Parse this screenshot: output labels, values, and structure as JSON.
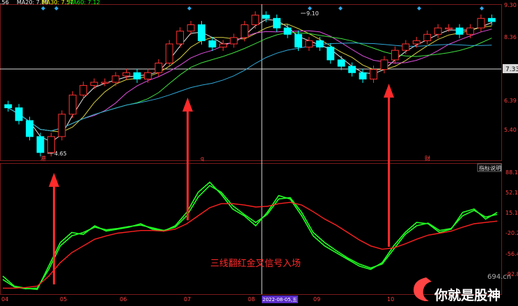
{
  "legend": [
    {
      "text": "MA20: 7.88",
      "color": "#e8e8e8"
    },
    {
      "text": "MA30: 7.57",
      "color": "#ffff00"
    },
    {
      "text": "MA60: 7.12",
      "color": "#00ff00"
    }
  ],
  "top_left_prefix": ".56",
  "price_axis": [
    "9.30",
    "8.36",
    "7.33",
    "6.39",
    "5.40"
  ],
  "current_price_label": "7.33",
  "indicator_axis": [
    "88.1",
    "52.1",
    "15.1",
    "-20.2",
    "-56.4",
    "-92.8"
  ],
  "annotations": {
    "high": "9.10",
    "low": "4.65",
    "markers": [
      "港",
      "q",
      "财"
    ],
    "indicator_button": "指标说明",
    "signal_text": "三线翻红金叉信号入场",
    "date_highlight": "2022-08-05,五",
    "watermark_small": "694.cn",
    "watermark_big": "你就是股神"
  },
  "time_axis": [
    "04",
    "05",
    "06",
    "07",
    "08",
    "09",
    "10"
  ],
  "colors": {
    "background": "#000000",
    "up": "#ff3030",
    "down": "#00ffff",
    "ma_green": "#40e040",
    "ma_magenta": "#e050e0",
    "ma_yellow": "#d8d040",
    "ma_white": "#e8e8e8",
    "ma_cyan": "#30a8d8",
    "ind_green": "#22ff22",
    "ind_red": "#ff2020",
    "axis_text": "#ff4040",
    "grid": "#7a1a1a"
  },
  "chart_data": [
    {
      "type": "candlestick",
      "title": "",
      "ylim": [
        4.5,
        9.3
      ],
      "x": [
        "04",
        "05",
        "06",
        "07",
        "08",
        "09",
        "10"
      ],
      "series": [
        {
          "name": "close",
          "values": [
            6.1,
            5.7,
            5.2,
            4.7,
            5.2,
            5.9,
            6.5,
            6.8,
            6.9,
            6.9,
            7.1,
            7.2,
            7.0,
            7.2,
            7.5,
            8.1,
            8.5,
            8.7,
            8.2,
            8.0,
            8.1,
            8.3,
            8.7,
            9.0,
            8.9,
            8.6,
            8.4,
            8.0,
            8.2,
            8.0,
            7.6,
            7.4,
            7.2,
            7.0,
            7.3,
            7.6,
            7.9,
            8.1,
            8.2,
            8.4,
            8.6,
            8.6,
            8.4,
            8.6,
            8.9,
            8.8
          ]
        }
      ]
    },
    {
      "type": "line",
      "title": "",
      "ylim": [
        -92.8,
        88.1
      ],
      "series": [
        {
          "name": "",
          "values": [
            -70,
            -85,
            -88,
            -90,
            -55,
            -20,
            -5,
            -8,
            5,
            -3,
            0,
            3,
            8,
            0,
            -3,
            5,
            25,
            55,
            70,
            52,
            30,
            20,
            5,
            25,
            50,
            45,
            20,
            -10,
            -25,
            -35,
            -45,
            -55,
            -60,
            -50,
            -25,
            -5,
            10,
            8,
            -5,
            0,
            25,
            30,
            15,
            25
          ]
        },
        {
          "name": "",
          "values": [
            -75,
            -86,
            -89,
            -88,
            -60,
            -25,
            -10,
            -5,
            3,
            -1,
            1,
            4,
            6,
            2,
            -2,
            3,
            20,
            48,
            65,
            55,
            35,
            22,
            10,
            22,
            45,
            47,
            25,
            -5,
            -20,
            -32,
            -43,
            -52,
            -58,
            -52,
            -30,
            -8,
            5,
            9,
            -2,
            1,
            20,
            28,
            18,
            22
          ]
        },
        {
          "name": "",
          "values": [
            -88,
            -88,
            -87,
            -85,
            -70,
            -50,
            -35,
            -25,
            -15,
            -10,
            -6,
            -4,
            -2,
            -2,
            -3,
            0,
            8,
            20,
            32,
            38,
            38,
            36,
            33,
            34,
            38,
            40,
            36,
            26,
            15,
            6,
            -5,
            -16,
            -25,
            -30,
            -28,
            -22,
            -15,
            -9,
            -6,
            -3,
            3,
            8,
            10,
            12
          ]
        }
      ]
    }
  ]
}
